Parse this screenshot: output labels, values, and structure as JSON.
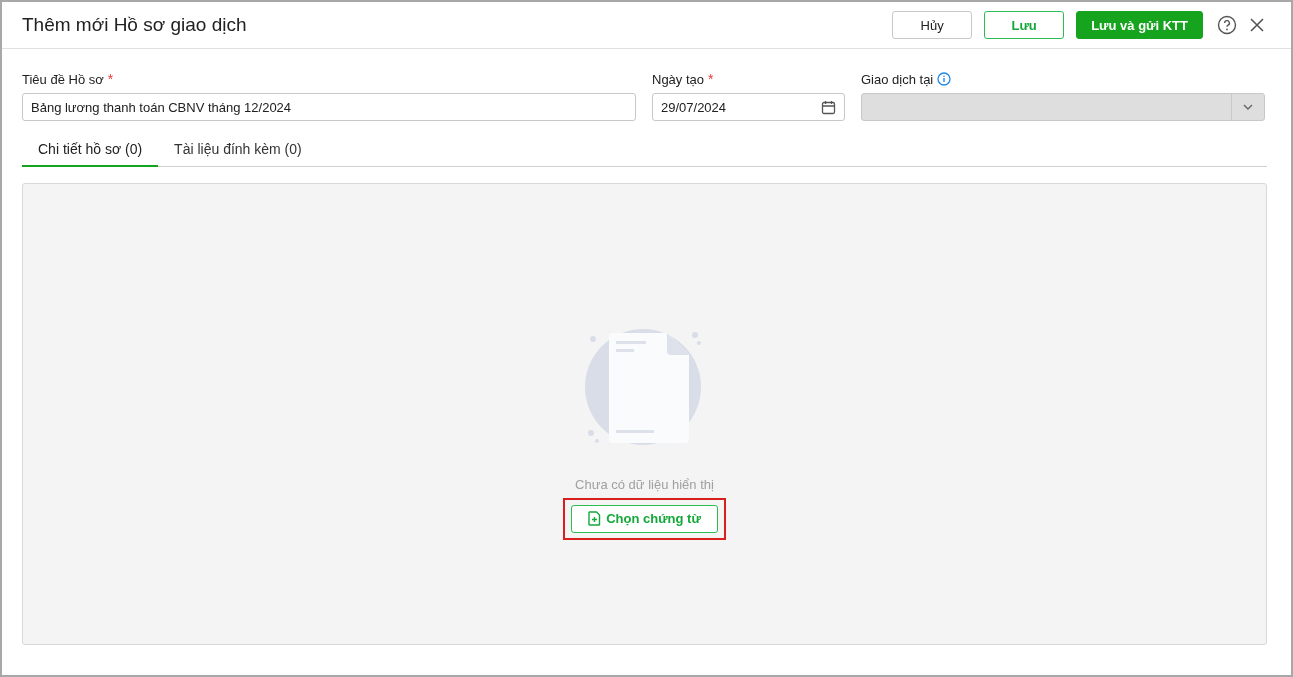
{
  "window": {
    "title": "Thêm mới Hồ sơ giao dịch"
  },
  "header_buttons": [
    {
      "label": "Hủy",
      "kind": "plain"
    },
    {
      "label": "Lưu",
      "kind": "outline"
    },
    {
      "label": "Lưu và gửi KTT",
      "kind": "primary"
    }
  ],
  "fields": [
    {
      "label": "Tiêu đề Hồ sơ",
      "required_mark": "*",
      "kind": "text",
      "value": "Bảng lương thanh toán CBNV tháng 12/2024",
      "disabled": false
    },
    {
      "label": "Ngày tạo",
      "required_mark": "*",
      "kind": "date",
      "value": "29/07/2024",
      "disabled": false
    },
    {
      "label": "Giao dịch tại",
      "kind": "select",
      "info": true,
      "disabled": true
    }
  ],
  "tabs": [
    {
      "label": "Chi tiết hồ sơ (0)",
      "selected": true
    },
    {
      "label": "Tài liệu đính kèm (0)",
      "selected": false
    }
  ],
  "empty_state": {
    "message": "Chưa có dữ liệu hiển thị",
    "button": "Chọn chứng từ",
    "highlighted": true
  }
}
